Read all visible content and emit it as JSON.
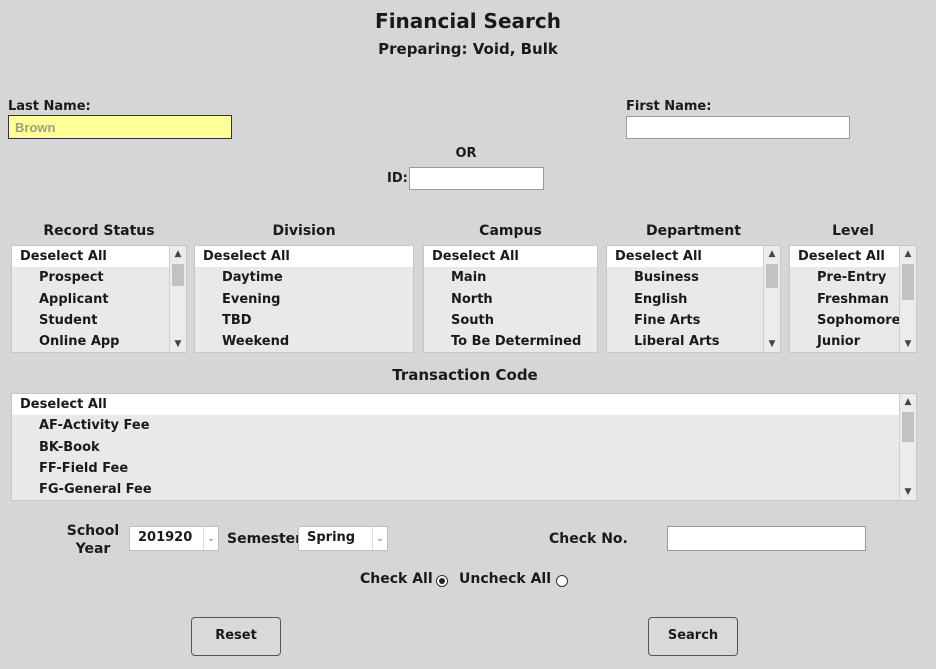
{
  "header": {
    "title": "Financial Search",
    "subtitle": "Preparing: Void, Bulk"
  },
  "name_search": {
    "last_name_label": "Last Name:",
    "last_name_value": "Brown",
    "first_name_label": "First Name:",
    "first_name_value": "",
    "or_label": "OR",
    "id_label": "ID:",
    "id_value": ""
  },
  "filters": {
    "record_status": {
      "label": "Record Status",
      "items": [
        "Deselect All",
        "Prospect",
        "Applicant",
        "Student",
        "Online App"
      ]
    },
    "division": {
      "label": "Division",
      "items": [
        "Deselect All",
        "Daytime",
        "Evening",
        "TBD",
        "Weekend"
      ]
    },
    "campus": {
      "label": "Campus",
      "items": [
        "Deselect All",
        "Main",
        "North",
        "South",
        "To Be Determined"
      ]
    },
    "department": {
      "label": "Department",
      "items": [
        "Deselect All",
        "Business",
        "English",
        "Fine Arts",
        "Liberal Arts"
      ]
    },
    "level": {
      "label": "Level",
      "items": [
        "Deselect All",
        "Pre-Entry",
        "Freshman",
        "Sophomore",
        "Junior"
      ]
    }
  },
  "transaction_code": {
    "label": "Transaction Code",
    "items": [
      "Deselect All",
      "AF-Activity Fee",
      "BK-Book",
      "FF-Field Fee",
      "FG-General Fee"
    ]
  },
  "term": {
    "school_year_label_line1": "School",
    "school_year_label_line2": "Year",
    "school_year_value": "201920",
    "semester_label": "Semester",
    "semester_value": "Spring",
    "check_no_label": "Check No.",
    "check_no_value": ""
  },
  "check_options": {
    "check_all_label": "Check All",
    "uncheck_all_label": "Uncheck All",
    "selected": "check_all"
  },
  "actions": {
    "reset_label": "Reset",
    "search_label": "Search"
  }
}
